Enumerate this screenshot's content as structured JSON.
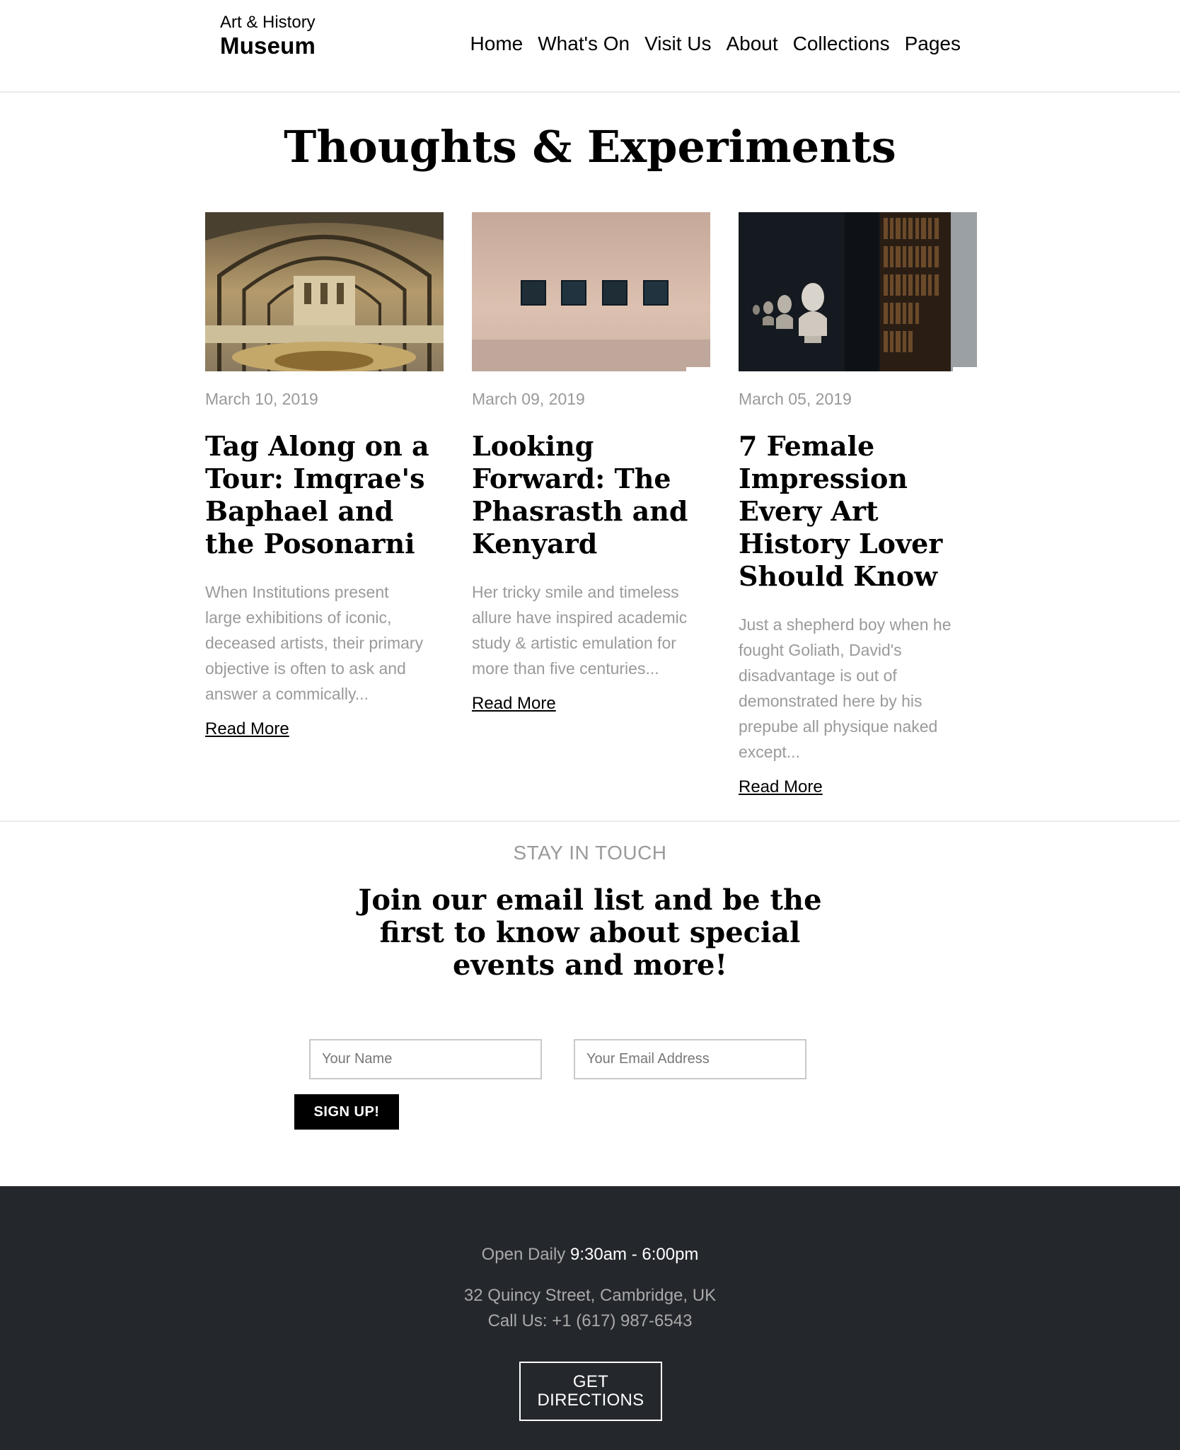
{
  "header": {
    "logo_top": "Art & History",
    "logo_main": "Museum",
    "nav": [
      "Home",
      "What's On",
      "Visit Us",
      "About",
      "Collections",
      "Pages"
    ]
  },
  "blog": {
    "title": "Thoughts & Experiments",
    "posts": [
      {
        "date": "March 10, 2019",
        "title": "Tag Along on a Tour: Imqrae's Baphael and the Posonarni",
        "excerpt": "When Institutions present large exhibitions of iconic, deceased artists, their primary objective is often to ask and answer a commically...",
        "read_more": "Read More"
      },
      {
        "date": "March 09, 2019",
        "title": "Looking Forward: The Phasrasth and Kenyard",
        "excerpt": "Her tricky smile and timeless allure have inspired academic study & artistic emulation for more than five centuries...",
        "read_more": "Read More"
      },
      {
        "date": "March 05, 2019",
        "title": "7 Female Impression Every Art History Lover Should Know",
        "excerpt": "Just a shepherd boy when he fought Goliath, David's disadvantage is out of demonstrated here by his prepube all physique naked except...",
        "read_more": "Read More"
      }
    ]
  },
  "newsletter": {
    "eyebrow": "STAY IN TOUCH",
    "heading": "Join our email list and be the first to know about special events and more!",
    "name_placeholder": "Your Name",
    "email_placeholder": "Your Email Address",
    "button": "SIGN UP!"
  },
  "footer": {
    "hours_label": "Open Daily",
    "hours_value": "9:30am - 6:00pm",
    "address": "32 Quincy Street, Cambridge, UK",
    "phone": "Call Us: +1 (617) 987-6543",
    "directions_line1": "GET",
    "directions_line2": "DIRECTIONS"
  },
  "colors": {
    "footer_bg": "#24272c",
    "muted_text": "#9a9a9a",
    "button_bg": "#000000"
  }
}
